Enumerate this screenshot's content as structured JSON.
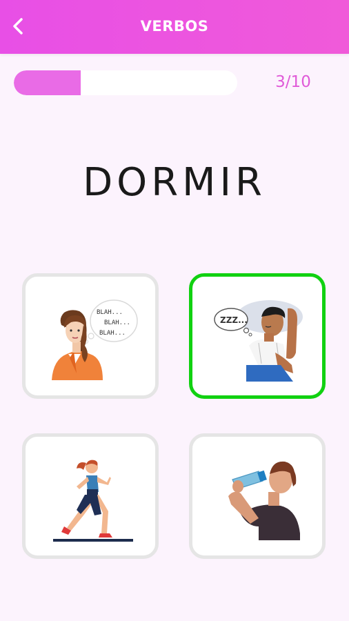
{
  "header": {
    "title": "VERBOS",
    "back_icon": "chevron-left-icon"
  },
  "progress": {
    "current": 3,
    "total": 10,
    "label": "3/10",
    "fraction": 0.3
  },
  "question": {
    "word": "DORMIR"
  },
  "options": [
    {
      "name": "talking-woman",
      "bubble_lines": [
        "BLAH...",
        "BLAH...",
        "BLAH..."
      ],
      "state": "default"
    },
    {
      "name": "sleeping-man",
      "bubble_text": "ZZZ...",
      "state": "correct"
    },
    {
      "name": "running-woman",
      "state": "default"
    },
    {
      "name": "drinking-man",
      "state": "default"
    }
  ],
  "colors": {
    "header": "#e84fe6",
    "accent": "#e05ad8",
    "correct": "#11d111",
    "background": "#fcf3fd"
  }
}
